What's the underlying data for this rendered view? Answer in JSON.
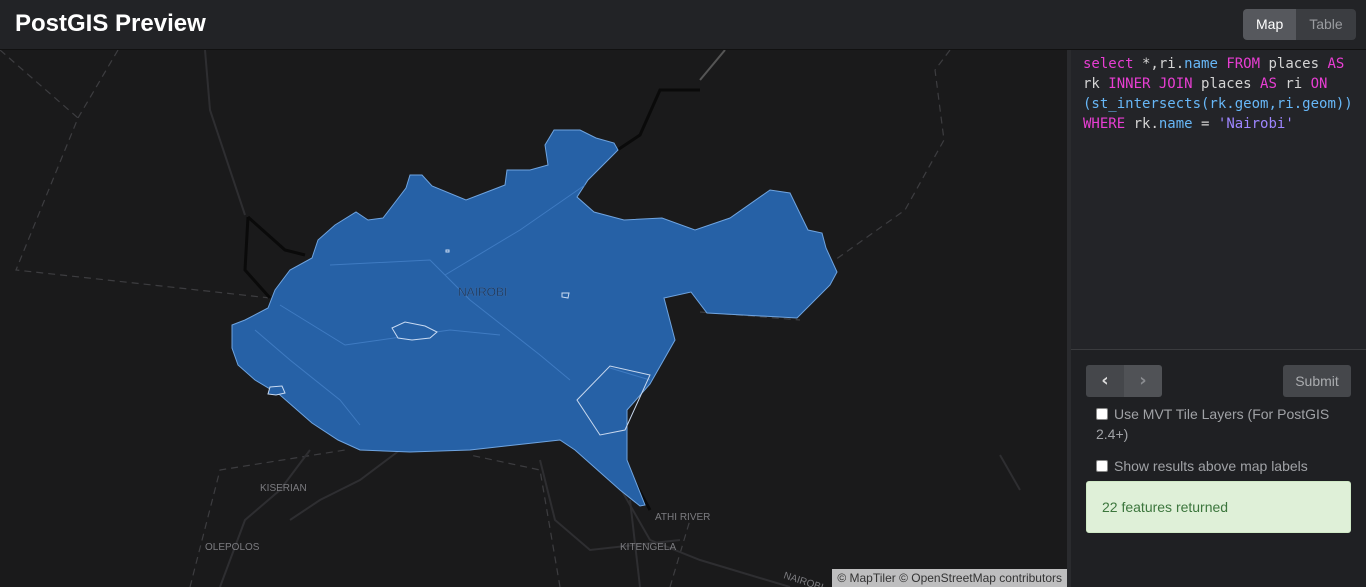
{
  "app": {
    "title": "PostGIS Preview",
    "view_tabs": [
      {
        "label": "Map",
        "active": true
      },
      {
        "label": "Table",
        "active": false
      }
    ]
  },
  "map": {
    "place_labels": {
      "nairobi": "NAIROBI",
      "kiserian": "KISERIAN",
      "olepolos": "OLEPOLOS",
      "athi_river": "ATHI RIVER",
      "kitengela": "KITENGELA",
      "nairobi_road": "NAIROBI"
    },
    "attribution": "© MapTiler © OpenStreetMap contributors",
    "feature_fill_color": "#2661a6",
    "feature_stroke_color": "#6fa4e0"
  },
  "editor": {
    "query_lines": [
      [
        "kw:select",
        "txt: *,ri.",
        "prop:name",
        "txt: ",
        "kw:FROM",
        "txt: places ",
        "kw:AS"
      ],
      [
        "txt:rk ",
        "kw:INNER JOIN",
        "txt: places ",
        "kw:AS",
        "txt: ri ",
        "kw:ON"
      ],
      [
        "prop:(st_intersects(rk.",
        "prop:geom",
        "prop:,ri.",
        "prop:geom",
        "prop:))"
      ],
      [
        "kw:WHERE",
        "txt: rk.",
        "prop:name",
        "txt: = ",
        "str:'Nairobi'"
      ]
    ]
  },
  "controls": {
    "prev_icon": "chevron-left-icon",
    "next_icon": "chevron-right-icon",
    "submit_label": "Submit",
    "mvt_label": "Use MVT Tile Layers (For PostGIS 2.4+)",
    "labels_above_label": "Show results above map labels",
    "status_message": "22 features returned"
  }
}
